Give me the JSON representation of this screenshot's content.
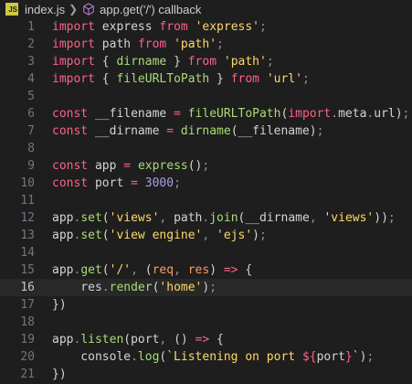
{
  "breadcrumb": {
    "file": "index.js",
    "symbol": "app.get('/') callback",
    "file_icon": "js-file-icon",
    "symbol_icon": "cube-icon"
  },
  "lines": [
    {
      "n": "1",
      "tokens": [
        [
          "kw",
          "import"
        ],
        [
          "var",
          " express "
        ],
        [
          "kw",
          "from"
        ],
        [
          "var",
          " "
        ],
        [
          "str",
          "'express'"
        ],
        [
          "punc",
          ";"
        ]
      ]
    },
    {
      "n": "2",
      "tokens": [
        [
          "kw",
          "import"
        ],
        [
          "var",
          " path "
        ],
        [
          "kw",
          "from"
        ],
        [
          "var",
          " "
        ],
        [
          "str",
          "'path'"
        ],
        [
          "punc",
          ";"
        ]
      ]
    },
    {
      "n": "3",
      "tokens": [
        [
          "kw",
          "import"
        ],
        [
          "var",
          " { "
        ],
        [
          "fn",
          "dirname"
        ],
        [
          "var",
          " } "
        ],
        [
          "kw",
          "from"
        ],
        [
          "var",
          " "
        ],
        [
          "str",
          "'path'"
        ],
        [
          "punc",
          ";"
        ]
      ]
    },
    {
      "n": "4",
      "tokens": [
        [
          "kw",
          "import"
        ],
        [
          "var",
          " { "
        ],
        [
          "fn",
          "fileURLToPath"
        ],
        [
          "var",
          " } "
        ],
        [
          "kw",
          "from"
        ],
        [
          "var",
          " "
        ],
        [
          "str",
          "'url'"
        ],
        [
          "punc",
          ";"
        ]
      ]
    },
    {
      "n": "5",
      "tokens": []
    },
    {
      "n": "6",
      "tokens": [
        [
          "kw",
          "const"
        ],
        [
          "var",
          " __filename "
        ],
        [
          "op",
          "="
        ],
        [
          "var",
          " "
        ],
        [
          "fn",
          "fileURLToPath"
        ],
        [
          "var",
          "("
        ],
        [
          "kw",
          "import"
        ],
        [
          "punc",
          "."
        ],
        [
          "var",
          "meta"
        ],
        [
          "punc",
          "."
        ],
        [
          "var",
          "url"
        ],
        [
          "var",
          ")"
        ],
        [
          "punc",
          ";"
        ]
      ]
    },
    {
      "n": "7",
      "tokens": [
        [
          "kw",
          "const"
        ],
        [
          "var",
          " __dirname "
        ],
        [
          "op",
          "="
        ],
        [
          "var",
          " "
        ],
        [
          "fn",
          "dirname"
        ],
        [
          "var",
          "(__filename)"
        ],
        [
          "punc",
          ";"
        ]
      ]
    },
    {
      "n": "8",
      "tokens": []
    },
    {
      "n": "9",
      "tokens": [
        [
          "kw",
          "const"
        ],
        [
          "var",
          " app "
        ],
        [
          "op",
          "="
        ],
        [
          "var",
          " "
        ],
        [
          "fn",
          "express"
        ],
        [
          "var",
          "()"
        ],
        [
          "punc",
          ";"
        ]
      ]
    },
    {
      "n": "10",
      "tokens": [
        [
          "kw",
          "const"
        ],
        [
          "var",
          " port "
        ],
        [
          "op",
          "="
        ],
        [
          "var",
          " "
        ],
        [
          "num",
          "3000"
        ],
        [
          "punc",
          ";"
        ]
      ]
    },
    {
      "n": "11",
      "tokens": []
    },
    {
      "n": "12",
      "tokens": [
        [
          "var",
          "app"
        ],
        [
          "punc",
          "."
        ],
        [
          "fn",
          "set"
        ],
        [
          "var",
          "("
        ],
        [
          "str",
          "'views'"
        ],
        [
          "punc",
          ","
        ],
        [
          "var",
          " path"
        ],
        [
          "punc",
          "."
        ],
        [
          "fn",
          "join"
        ],
        [
          "var",
          "(__dirname"
        ],
        [
          "punc",
          ","
        ],
        [
          "var",
          " "
        ],
        [
          "str",
          "'views'"
        ],
        [
          "var",
          "))"
        ],
        [
          "punc",
          ";"
        ]
      ]
    },
    {
      "n": "13",
      "tokens": [
        [
          "var",
          "app"
        ],
        [
          "punc",
          "."
        ],
        [
          "fn",
          "set"
        ],
        [
          "var",
          "("
        ],
        [
          "str",
          "'view engine'"
        ],
        [
          "punc",
          ","
        ],
        [
          "var",
          " "
        ],
        [
          "str",
          "'ejs'"
        ],
        [
          "var",
          ")"
        ],
        [
          "punc",
          ";"
        ]
      ]
    },
    {
      "n": "14",
      "tokens": []
    },
    {
      "n": "15",
      "tokens": [
        [
          "var",
          "app"
        ],
        [
          "punc",
          "."
        ],
        [
          "fn",
          "get"
        ],
        [
          "var",
          "("
        ],
        [
          "str",
          "'/'"
        ],
        [
          "punc",
          ","
        ],
        [
          "var",
          " ("
        ],
        [
          "param",
          "req"
        ],
        [
          "punc",
          ","
        ],
        [
          "var",
          " "
        ],
        [
          "param",
          "res"
        ],
        [
          "var",
          ") "
        ],
        [
          "op",
          "=>"
        ],
        [
          "var",
          " "
        ],
        [
          "brk",
          "{"
        ]
      ]
    },
    {
      "n": "16",
      "active": true,
      "tokens": [
        [
          "var",
          "    res"
        ],
        [
          "punc",
          "."
        ],
        [
          "fn",
          "render"
        ],
        [
          "var",
          "("
        ],
        [
          "str",
          "'home'"
        ],
        [
          "var",
          ")"
        ],
        [
          "punc",
          ";"
        ]
      ]
    },
    {
      "n": "17",
      "tokens": [
        [
          "brk",
          "}"
        ],
        [
          "var",
          ")"
        ]
      ]
    },
    {
      "n": "18",
      "tokens": []
    },
    {
      "n": "19",
      "tokens": [
        [
          "var",
          "app"
        ],
        [
          "punc",
          "."
        ],
        [
          "fn",
          "listen"
        ],
        [
          "var",
          "(port"
        ],
        [
          "punc",
          ","
        ],
        [
          "var",
          " () "
        ],
        [
          "op",
          "=>"
        ],
        [
          "var",
          " {"
        ]
      ]
    },
    {
      "n": "20",
      "tokens": [
        [
          "var",
          "    console"
        ],
        [
          "punc",
          "."
        ],
        [
          "fn",
          "log"
        ],
        [
          "var",
          "("
        ],
        [
          "str",
          "`Listening on port "
        ],
        [
          "op",
          "${"
        ],
        [
          "var",
          "port"
        ],
        [
          "op",
          "}"
        ],
        [
          "str",
          "`"
        ],
        [
          "var",
          ")"
        ],
        [
          "punc",
          ";"
        ]
      ]
    },
    {
      "n": "21",
      "tokens": [
        [
          "var",
          "})"
        ]
      ]
    }
  ]
}
